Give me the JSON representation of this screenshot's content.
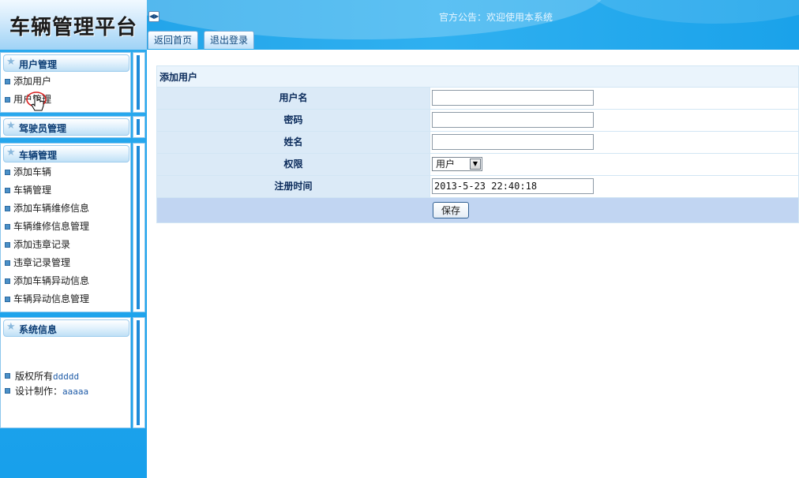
{
  "app": {
    "title": "车辆管理平台"
  },
  "header": {
    "announcement": "官方公告：欢迎使用本系统",
    "tabs": [
      {
        "label": "返回首页"
      },
      {
        "label": "退出登录"
      }
    ],
    "toggle_icon": "collapse-arrows-icon"
  },
  "sidebar": {
    "sections": [
      {
        "title": "用户管理",
        "items": [
          {
            "label": "添加用户"
          },
          {
            "label": "用户管理"
          }
        ]
      },
      {
        "title": "驾驶员管理",
        "items": []
      },
      {
        "title": "车辆管理",
        "items": [
          {
            "label": "添加车辆"
          },
          {
            "label": "车辆管理"
          },
          {
            "label": "添加车辆维修信息"
          },
          {
            "label": "车辆维修信息管理"
          },
          {
            "label": "添加违章记录"
          },
          {
            "label": "违章记录管理"
          },
          {
            "label": "添加车辆异动信息"
          },
          {
            "label": "车辆异动信息管理"
          }
        ]
      },
      {
        "title": "系统信息",
        "info": [
          {
            "label": "版权所有",
            "value": "ddddd"
          },
          {
            "label": "设计制作：",
            "value": "aaaaa"
          }
        ]
      }
    ]
  },
  "form": {
    "title": "添加用户",
    "fields": {
      "username": {
        "label": "用户名",
        "value": ""
      },
      "password": {
        "label": "密码",
        "value": ""
      },
      "name": {
        "label": "姓名",
        "value": ""
      },
      "role": {
        "label": "权限",
        "value": "用户"
      },
      "register_time": {
        "label": "注册时间",
        "value": "2013-5-23 22:40:18"
      }
    },
    "save_label": "保存"
  },
  "colors": {
    "header_blue": "#1d9fe6",
    "sidebar_blue": "#18a0eb",
    "label_cell": "#dbeaf7",
    "save_row": "#c1d5f2"
  }
}
